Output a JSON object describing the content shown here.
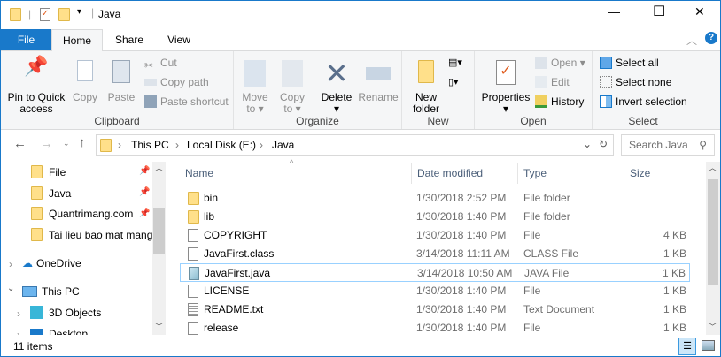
{
  "window": {
    "title": "Java",
    "controls": {
      "minimize": "—",
      "maximize": "☐",
      "close": "✕"
    }
  },
  "ribbon_tabs": [
    {
      "label": "File"
    },
    {
      "label": "Home"
    },
    {
      "label": "Share"
    },
    {
      "label": "View"
    }
  ],
  "ribbon": {
    "clipboard": {
      "label": "Clipboard",
      "pin": "Pin to Quick access",
      "pin_l1": "Pin to Quick",
      "pin_l2": "access",
      "copy": "Copy",
      "paste": "Paste",
      "cut": "Cut",
      "copy_path": "Copy path",
      "paste_shortcut": "Paste shortcut"
    },
    "organize": {
      "label": "Organize",
      "move_l1": "Move",
      "move_l2": "to",
      "copy_l1": "Copy",
      "copy_l2": "to",
      "delete": "Delete",
      "rename": "Rename"
    },
    "new": {
      "label": "New",
      "new_l1": "New",
      "new_l2": "folder"
    },
    "open": {
      "label": "Open",
      "properties": "Properties",
      "open": "Open",
      "edit": "Edit",
      "history": "History"
    },
    "select": {
      "label": "Select",
      "select_all": "Select all",
      "select_none": "Select none",
      "invert": "Invert selection"
    }
  },
  "address": {
    "crumbs": [
      "This PC",
      "Local Disk (E:)",
      "Java"
    ],
    "search_placeholder": "Search Java"
  },
  "nav": {
    "items": [
      {
        "label": "File",
        "pinned": true
      },
      {
        "label": "Java",
        "pinned": true
      },
      {
        "label": "Quantrimang.com",
        "pinned": true
      },
      {
        "label": "Tai lieu bao mat mang",
        "pinned": false
      },
      {
        "label": "OneDrive"
      },
      {
        "label": "This PC"
      },
      {
        "label": "3D Objects"
      },
      {
        "label": "Desktop"
      }
    ]
  },
  "columns": {
    "name": "Name",
    "date": "Date modified",
    "type": "Type",
    "size": "Size"
  },
  "files": [
    {
      "name": "bin",
      "date": "1/30/2018 2:52 PM",
      "type": "File folder",
      "size": "",
      "icon": "folder"
    },
    {
      "name": "lib",
      "date": "1/30/2018 1:40 PM",
      "type": "File folder",
      "size": "",
      "icon": "folder"
    },
    {
      "name": "COPYRIGHT",
      "date": "1/30/2018 1:40 PM",
      "type": "File",
      "size": "4 KB",
      "icon": "file"
    },
    {
      "name": "JavaFirst.class",
      "date": "3/14/2018 11:11 AM",
      "type": "CLASS File",
      "size": "1 KB",
      "icon": "file"
    },
    {
      "name": "JavaFirst.java",
      "date": "3/14/2018 10:50 AM",
      "type": "JAVA File",
      "size": "1 KB",
      "icon": "java-file",
      "selected": true
    },
    {
      "name": "LICENSE",
      "date": "1/30/2018 1:40 PM",
      "type": "File",
      "size": "1 KB",
      "icon": "file"
    },
    {
      "name": "README.txt",
      "date": "1/30/2018 1:40 PM",
      "type": "Text Document",
      "size": "1 KB",
      "icon": "text-file"
    },
    {
      "name": "release",
      "date": "1/30/2018 1:40 PM",
      "type": "File",
      "size": "1 KB",
      "icon": "file"
    }
  ],
  "status": {
    "count": "11 items"
  },
  "colors": {
    "accent": "#1979ca",
    "selection_border": "#99d1ff"
  }
}
